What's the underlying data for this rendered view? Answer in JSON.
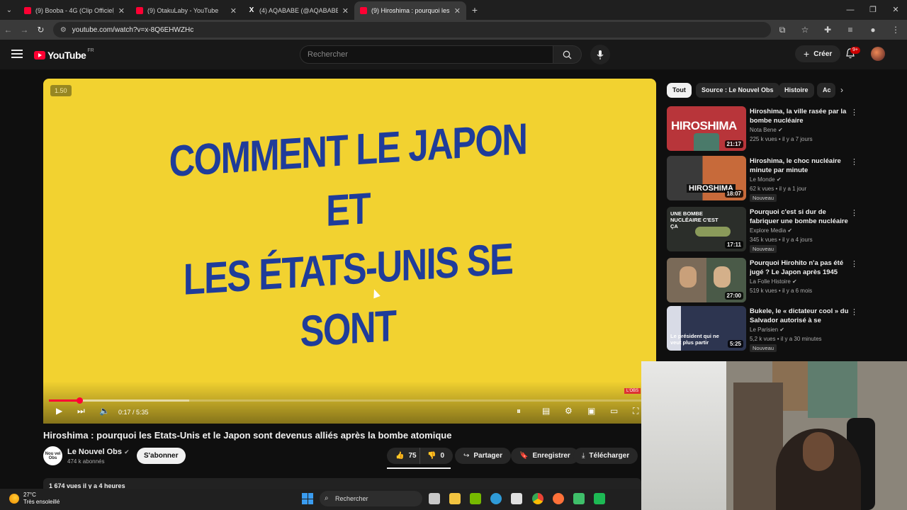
{
  "browser": {
    "tabs": [
      {
        "label": "(9) Booba - 4G (Clip Officiel) - Y",
        "icon": "youtube-icon",
        "active": false
      },
      {
        "label": "(9) OtakuLaby - YouTube",
        "icon": "youtube-icon",
        "active": false
      },
      {
        "label": "(4) AQABABE (@AQABABE_) / X",
        "icon": "x-icon",
        "active": false
      },
      {
        "label": "(9) Hiroshima : pourquoi les Etats",
        "icon": "youtube-icon",
        "active": true
      }
    ],
    "url": "youtube.com/watch?v=x-8Q6EHWZHc"
  },
  "header": {
    "logo": "YouTube",
    "region": "FR",
    "search_placeholder": "Rechercher",
    "create_label": "Créer",
    "notif_count": "9+"
  },
  "player": {
    "speed_badge": "1.50",
    "headline_line1": "COMMENT LE JAPON ET",
    "headline_line2": "LES ÉTATS-UNIS SE SONT",
    "time": "0:17 / 5:35",
    "progress_fraction": 0.051,
    "buffer_fraction": 0.233,
    "corner_mark": "L'OBS"
  },
  "video": {
    "title": "Hiroshima : pourquoi les Etats-Unis et le Japon sont devenus alliés après la bombe atomique",
    "channel": "Le Nouvel Obs",
    "channel_avatar_text": "Nou vel Obs",
    "subscribers": "474 k abonnés",
    "subscribe_label": "S'abonner",
    "likes": "75",
    "dislikes": "0",
    "share_label": "Partager",
    "save_label": "Enregistrer",
    "download_label": "Télécharger",
    "views_line": "1 674 vues  il y a 4 heures"
  },
  "chips": [
    "Tout",
    "Source : Le Nouvel Obs",
    "Histoire",
    "Ac"
  ],
  "recommendations": [
    {
      "title": "Hiroshima, la ville rasée par la bombe nucléaire",
      "channel": "Nota Bene",
      "meta": "225 k vues • il y a 7 jours",
      "duration": "21:17",
      "badge": "",
      "thumb_text": "HIROSHIMA",
      "thumb_color": "#b8353a"
    },
    {
      "title": "Hiroshima, le choc nucléaire minute par minute",
      "channel": "Le Monde",
      "meta": "62 k vues • il y a 1 jour",
      "duration": "18:07",
      "badge": "Nouveau",
      "thumb_text": "HIROSHIMA",
      "thumb_color": "#8a6a55"
    },
    {
      "title": "Pourquoi c'est si dur de fabriquer une bombe nucléaire ?",
      "channel": "Explore Media",
      "meta": "345 k vues • il y a 4 jours",
      "duration": "17:11",
      "badge": "Nouveau",
      "thumb_text": "UNE BOMBE NUCLÉAIRE C'EST ÇA",
      "thumb_color": "#2b2e2a"
    },
    {
      "title": "Pourquoi Hirohito n'a pas été jugé ? Le Japon après 1945",
      "channel": "La Folle Histoire",
      "meta": "519 k vues • il y a 6 mois",
      "duration": "27:00",
      "badge": "",
      "thumb_text": "",
      "thumb_color": "#6a5a48"
    },
    {
      "title": "Bukele, le « dictateur cool » du Salvador autorisé à se présent...",
      "channel": "Le Parisien",
      "meta": "5,2 k vues • il y a 30 minutes",
      "duration": "5:25",
      "badge": "Nouveau",
      "thumb_text": "Le président qui ne veut plus partir",
      "thumb_color": "#2d3550"
    }
  ],
  "taskbar": {
    "temp": "27°C",
    "weather": "Très ensoleillé",
    "search_label": "Rechercher"
  }
}
